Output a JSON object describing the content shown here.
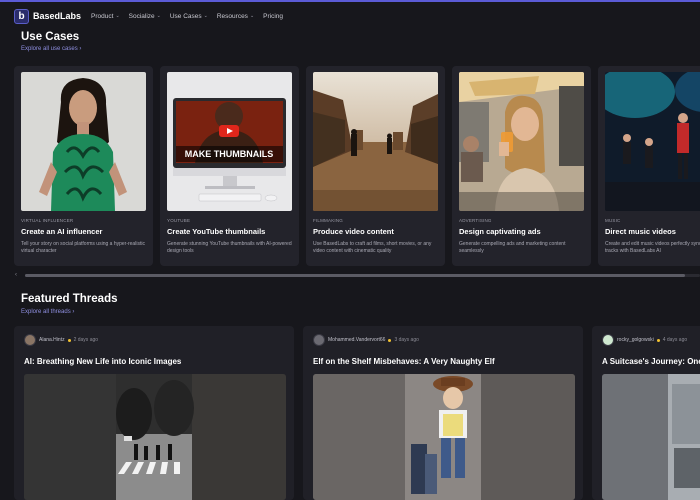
{
  "nav": {
    "logo_letter": "b",
    "brand": "BasedLabs",
    "items": [
      {
        "label": "Product",
        "dropdown": true
      },
      {
        "label": "Socialize",
        "dropdown": true
      },
      {
        "label": "Use Cases",
        "dropdown": true
      },
      {
        "label": "Resources",
        "dropdown": true
      },
      {
        "label": "Pricing",
        "dropdown": false
      }
    ],
    "chevron": "⌄"
  },
  "use_cases": {
    "title": "Use Cases",
    "link": "Explore all use cases ›",
    "cards": [
      {
        "tag": "VIRTUAL INFLUENCER",
        "title": "Create an AI influencer",
        "desc": "Tell your story on social platforms using a hyper-realistic virtual character"
      },
      {
        "tag": "YOUTUBE",
        "title": "Create YouTube thumbnails",
        "desc": "Generate stunning YouTube thumbnails with AI-powered design tools",
        "thumb_text": "MAKE THUMBNAILS"
      },
      {
        "tag": "FILMMAKING",
        "title": "Produce video content",
        "desc": "Use BasedLabs to craft ad films, short movies, or any video content with cinematic quality"
      },
      {
        "tag": "ADVERTISING",
        "title": "Design captivating ads",
        "desc": "Generate compelling ads and marketing content seamlessly"
      },
      {
        "tag": "MUSIC",
        "title": "Direct music videos",
        "desc": "Create and edit music videos perfectly synced to your tracks with BasedLabs AI"
      }
    ],
    "scroll_left": "‹"
  },
  "featured": {
    "title": "Featured Threads",
    "link": "Explore all threads ›",
    "threads": [
      {
        "user": "Alana.Hintz",
        "ago": "2 days ago",
        "title": "AI: Breathing New Life into Iconic Images"
      },
      {
        "user": "Mohammed.Vandervort66",
        "ago": "3 days ago",
        "title": "Elf on the Shelf Misbehaves: A Very Naughty Elf"
      },
      {
        "user": "rocky_golgowski",
        "ago": "4 days ago",
        "title": "A Suitcase's Journey: One"
      }
    ]
  },
  "colors": {
    "accent": "#5b5bd6",
    "link": "#8f8fe0",
    "background": "#17171c",
    "card": "#23232b",
    "online_dot": "#f2c230"
  }
}
